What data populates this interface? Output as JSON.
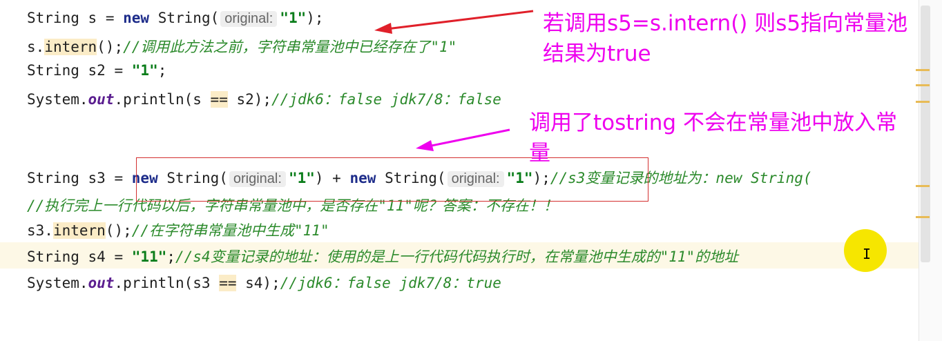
{
  "code": {
    "l1": {
      "type": "String",
      "var": "s",
      "eq": "=",
      "kw": "new",
      "ctor": "String(",
      "hint": "original:",
      "str": "\"1\"",
      "end": ");"
    },
    "l2": {
      "obj": "s.",
      "method": "intern",
      "rest": "();",
      "comment": "//调用此方法之前，字符串常量池中已经存在了\"1\""
    },
    "l3": {
      "type": "String",
      "var": "s2",
      "eq": "=",
      "str": "\"1\"",
      "end": ";"
    },
    "l4": {
      "prefix": "System.",
      "out": "out",
      "print": ".println(s",
      "op": "==",
      "rest": "s2);",
      "comment": "//jdk6：false   jdk7/8：false"
    },
    "l5": {
      "type": "String",
      "var": "s3",
      "eq": "=",
      "kw": "new",
      "ctor": "String(",
      "hint": "original:",
      "str": "\"1\"",
      "plus": ") +",
      "kw2": "new",
      "ctor2": "String(",
      "hint2": "original:",
      "str2": "\"1\"",
      "end": ");",
      "comment": "//s3变量记录的地址为：new String("
    },
    "l6": {
      "comment": "//执行完上一行代码以后，字符串常量池中，是否存在\"11\"呢？答案：不存在！！"
    },
    "l7": {
      "obj": "s3.",
      "method": "intern",
      "rest": "();",
      "comment": "//在字符串常量池中生成\"11\""
    },
    "l8": {
      "type": "String",
      "var": "s4",
      "eq": "=",
      "str": "\"11\"",
      "end": ";",
      "comment": "//s4变量记录的地址：使用的是上一行代码代码执行时，在常量池中生成的\"11\"的地址"
    },
    "l9": {
      "prefix": "System.",
      "out": "out",
      "print": ".println(s3",
      "op": "==",
      "rest": "s4);",
      "comment": "//jdk6：false  jdk7/8：true"
    }
  },
  "annotations": {
    "a1_line1": "若调用s5=s.intern() 则s5指向常量池",
    "a1_line2": "结果为true",
    "a2_line1": "调用了tostring 不会在常量池中放入常",
    "a2_line2": "量"
  },
  "colors": {
    "annotation": "#ee00ee",
    "arrow": "#e0202a",
    "box": "#d32f2f",
    "cursor": "#f6e600"
  }
}
